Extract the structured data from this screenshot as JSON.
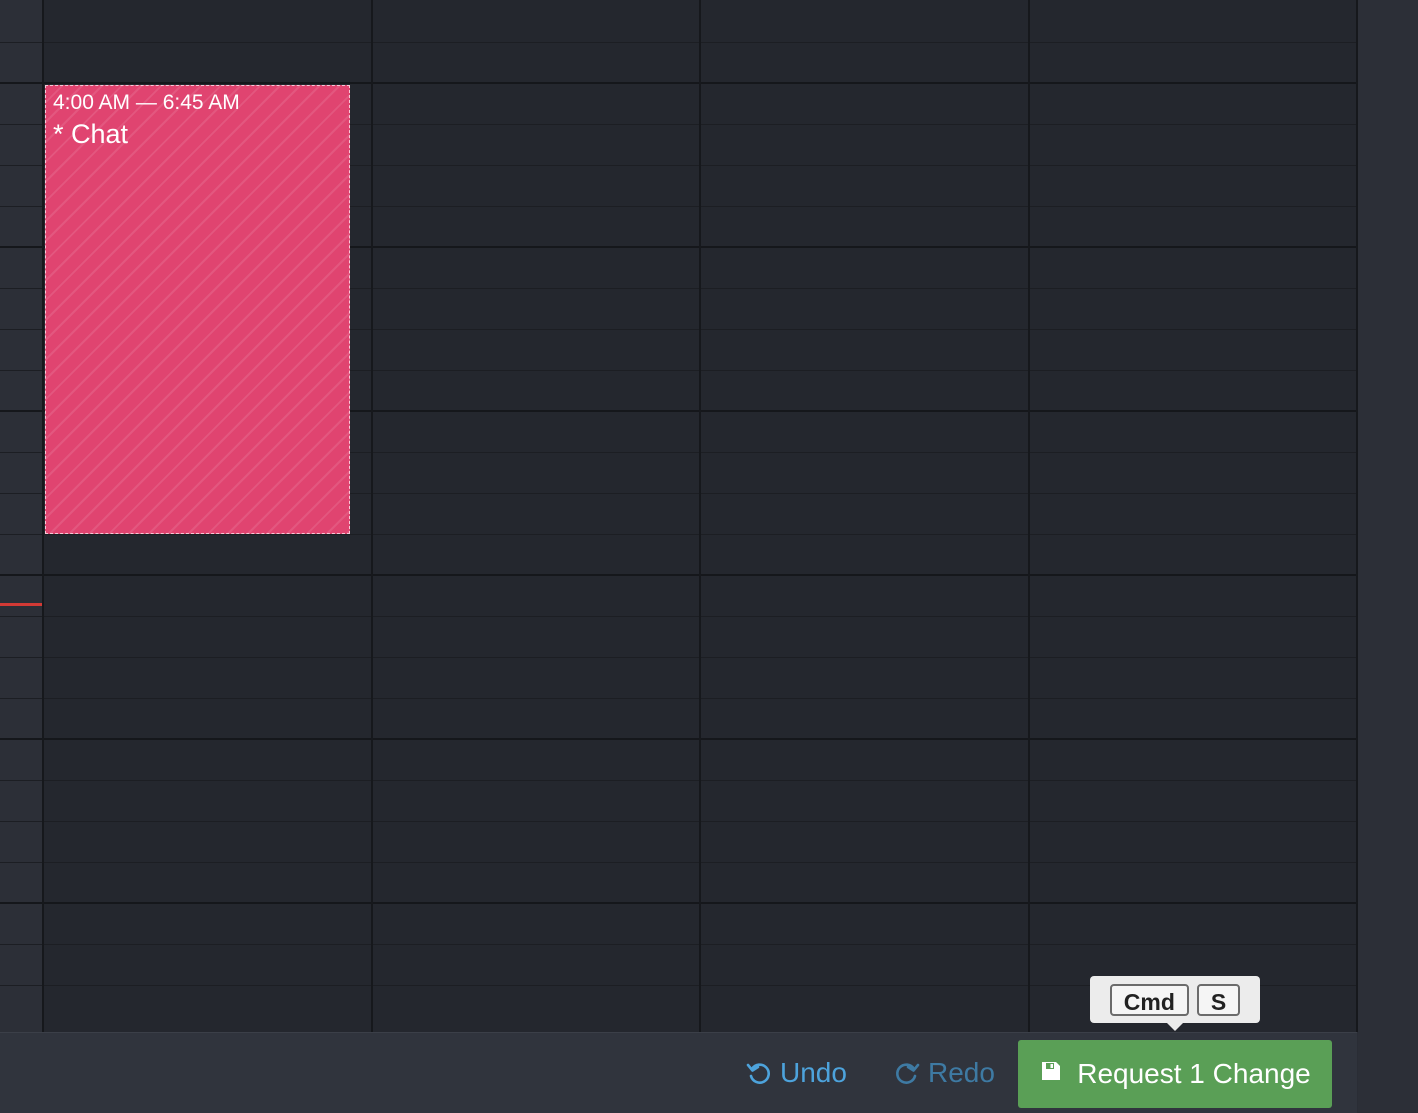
{
  "event": {
    "time": "4:00 AM — 6:45 AM",
    "title": "* Chat",
    "color": "#e04470"
  },
  "footer": {
    "undo_label": "Undo",
    "undo_icon": "undo-icon",
    "redo_label": "Redo",
    "redo_icon": "redo-icon",
    "request_label": "Request 1 Change",
    "request_icon": "save-icon",
    "request_color": "#5a9f56"
  },
  "shortcut": {
    "keys": [
      "Cmd",
      "S"
    ]
  },
  "colors": {
    "background": "#24272e",
    "current_time_line": "#d33a35",
    "link": "#4da3dc"
  }
}
